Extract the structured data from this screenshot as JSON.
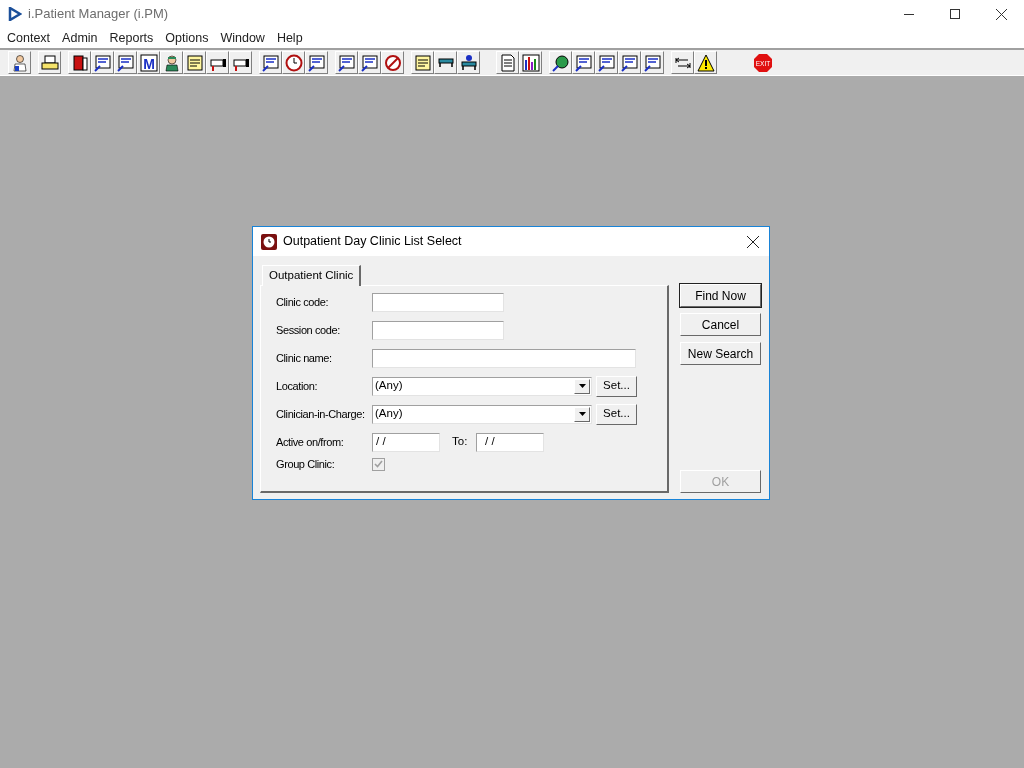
{
  "window": {
    "title": "i.Patient Manager (i.PM)"
  },
  "menu": [
    "Context",
    "Admin",
    "Reports",
    "Options",
    "Window",
    "Help"
  ],
  "toolbar": {
    "mail_letter": "M",
    "exit_label": "EXIT"
  },
  "dialog": {
    "title": "Outpatient Day Clinic List Select",
    "tabs": [
      {
        "label": "Outpatient Clinic",
        "selected": true
      }
    ],
    "fields": [
      {
        "kind": "text",
        "label": "Clinic code:",
        "wide": false
      },
      {
        "kind": "text",
        "label": "Session code:",
        "wide": false
      },
      {
        "kind": "text",
        "label": "Clinic name:",
        "wide": true
      },
      {
        "kind": "combo",
        "label": "Location:",
        "value": "(Any)",
        "button": "Set..."
      },
      {
        "kind": "combo",
        "label": "Clinician-in-Charge:",
        "value": "(Any)",
        "button": "Set..."
      },
      {
        "kind": "daterange",
        "label": "Active on/from:",
        "value": "/ /",
        "to_label": "To:",
        "to_value": "/ /"
      },
      {
        "kind": "checkbox",
        "label": "Group Clinic:",
        "checked": true,
        "disabled": true
      }
    ],
    "buttons": [
      {
        "label": "Find Now",
        "default": true
      },
      {
        "label": "Cancel",
        "default": false
      },
      {
        "label": "New Search",
        "default": false
      }
    ],
    "ok_button": {
      "label": "OK",
      "disabled": true
    }
  }
}
